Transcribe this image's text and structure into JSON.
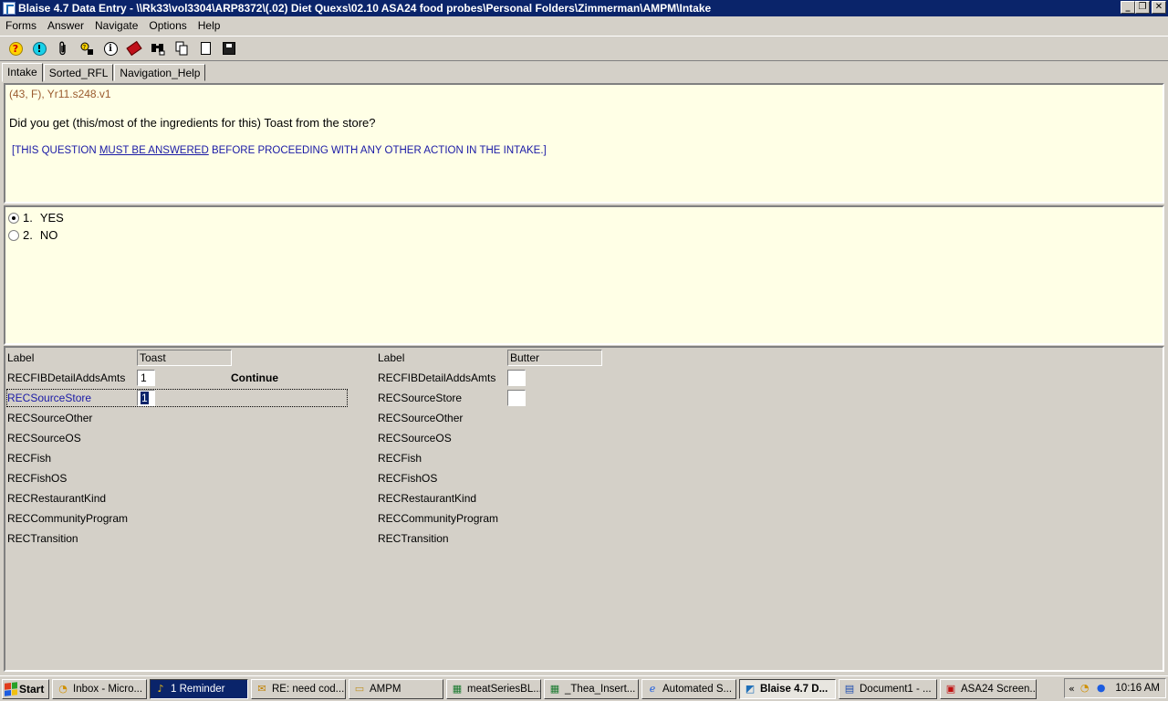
{
  "window": {
    "title": "Blaise 4.7 Data Entry - \\\\Rk33\\vol3304\\ARP8372\\(.02) Diet Quexs\\02.10 ASA24 food probes\\Personal Folders\\Zimmerman\\AMPM\\Intake",
    "min": "_",
    "max": "❐",
    "close": "✕"
  },
  "menu": {
    "items": [
      "Forms",
      "Answer",
      "Navigate",
      "Options",
      "Help"
    ]
  },
  "toolbar": {
    "icons": [
      "help-icon",
      "alert-icon",
      "paperclip-icon",
      "find-replace-icon",
      "info-icon",
      "tag-icon",
      "binoculars-icon",
      "copy-doc-icon",
      "new-doc-icon",
      "save-icon"
    ]
  },
  "tabs": [
    "Intake",
    "Sorted_RFL",
    "Navigation_Help"
  ],
  "question": {
    "id": "(43, F),  Yr11.s248.v1",
    "text": "Did you get (this/most of the ingredients for this) Toast from the store?",
    "warn_prefix": "[THIS QUESTION ",
    "warn_emph": "MUST BE ANSWERED",
    "warn_suffix": " BEFORE PROCEEDING WITH ANY OTHER ACTION IN THE INTAKE.]"
  },
  "answers": [
    {
      "code": "1.",
      "label": "YES",
      "selected": true
    },
    {
      "code": "2.",
      "label": "NO",
      "selected": false
    }
  ],
  "fields_left": {
    "label_title": "Label",
    "label_value": "Toast",
    "rows": [
      "RECFIBDetailAddsAmts",
      "RECSourceStore",
      "RECSourceOther",
      "RECSourceOS",
      "RECFish",
      "RECFishOS",
      "RECRestaurantKind",
      "RECCommunityProgram",
      "RECTransition"
    ],
    "adds_value": "1",
    "source_store_value": "1",
    "continue": "Continue"
  },
  "fields_right": {
    "label_title": "Label",
    "label_value": "Butter",
    "rows": [
      "RECFIBDetailAddsAmts",
      "RECSourceStore",
      "RECSourceOther",
      "RECSourceOS",
      "RECFish",
      "RECFishOS",
      "RECRestaurantKind",
      "RECCommunityProgram",
      "RECTransition"
    ]
  },
  "taskbar": {
    "start": "Start",
    "buttons": [
      {
        "label": "Inbox - Micro...",
        "icon": "outlook-icon",
        "style": "normal"
      },
      {
        "label": "1 Reminder",
        "icon": "bell-icon",
        "style": "dark"
      },
      {
        "label": "RE: need cod...",
        "icon": "mail-icon",
        "style": "normal"
      },
      {
        "label": "AMPM",
        "icon": "folder-icon",
        "style": "normal"
      },
      {
        "label": "meatSeriesBL...",
        "icon": "excel-icon",
        "style": "normal"
      },
      {
        "label": "_Thea_Insert...",
        "icon": "excel-icon",
        "style": "normal"
      },
      {
        "label": "Automated S...",
        "icon": "ie-icon",
        "style": "normal"
      },
      {
        "label": "Blaise 4.7 D...",
        "icon": "blaise-icon",
        "style": "pressed"
      },
      {
        "label": "Document1 - ...",
        "icon": "word-icon",
        "style": "normal"
      },
      {
        "label": "ASA24 Screen...",
        "icon": "pdf-icon",
        "style": "normal"
      }
    ],
    "clock": "10:16 AM"
  }
}
